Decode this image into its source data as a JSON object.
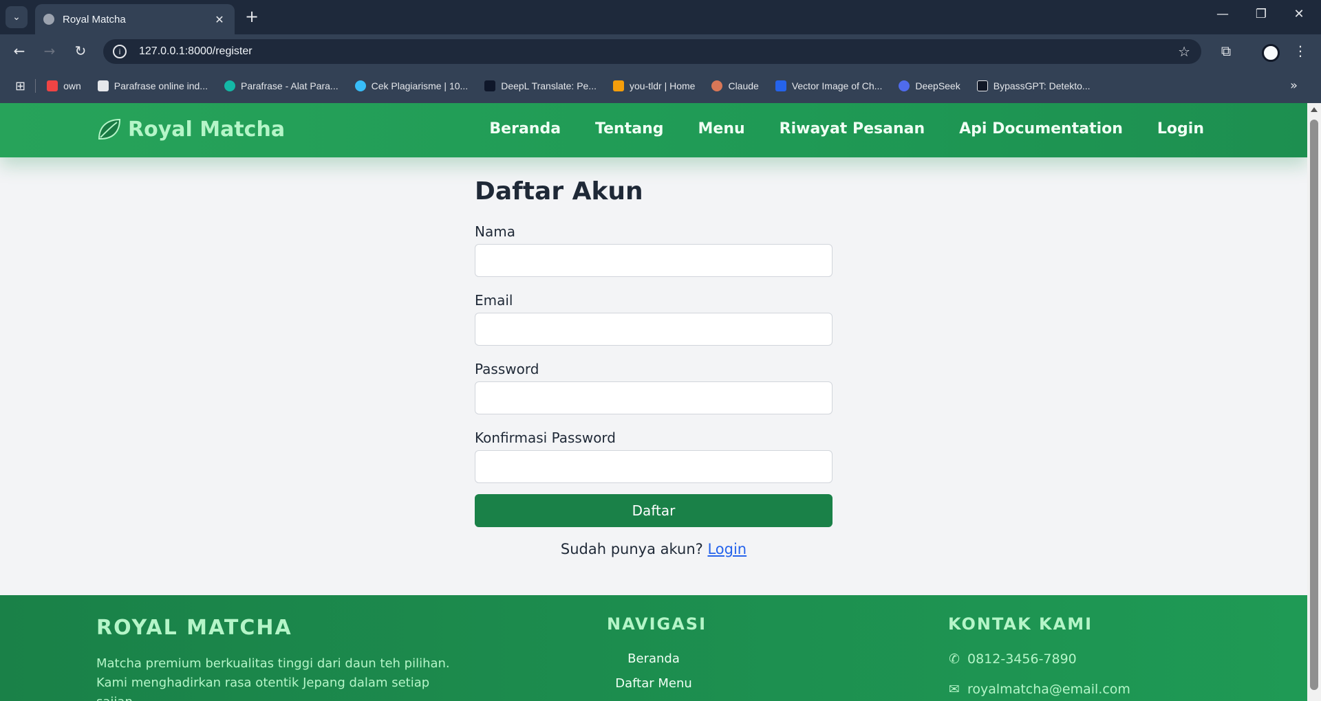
{
  "browser": {
    "tab_title": "Royal Matcha",
    "url": "127.0.0.1:8000/register",
    "bookmarks": [
      {
        "label": "own",
        "color": "#ef4444"
      },
      {
        "label": "Parafrase online ind...",
        "color": "#e5e7eb"
      },
      {
        "label": "Parafrase - Alat Para...",
        "color": "#14b8a6"
      },
      {
        "label": "Cek Plagiarisme | 10...",
        "color": "#38bdf8"
      },
      {
        "label": "DeepL Translate: Pe...",
        "color": "#0f172a"
      },
      {
        "label": "you-tldr | Home",
        "color": "#f59e0b"
      },
      {
        "label": "Claude",
        "color": "#d97757"
      },
      {
        "label": "Vector Image of Ch...",
        "color": "#2563eb"
      },
      {
        "label": "DeepSeek",
        "color": "#4f6bed"
      },
      {
        "label": "BypassGPT: Detekto...",
        "color": "#111827"
      }
    ]
  },
  "site": {
    "brand": "Royal Matcha",
    "nav": [
      "Beranda",
      "Tentang",
      "Menu",
      "Riwayat Pesanan",
      "Api Documentation",
      "Login"
    ],
    "colors": {
      "primary": "#1a8148",
      "accent": "#b5f5c8",
      "link": "#2563eb"
    }
  },
  "form": {
    "title": "Daftar Akun",
    "fields": [
      {
        "label": "Nama",
        "value": ""
      },
      {
        "label": "Email",
        "value": ""
      },
      {
        "label": "Password",
        "value": ""
      },
      {
        "label": "Konfirmasi Password",
        "value": ""
      }
    ],
    "submit_label": "Daftar",
    "login_prompt": "Sudah punya akun?",
    "login_link": "Login"
  },
  "footer": {
    "brand": "ROYAL MATCHA",
    "description": "Matcha premium berkualitas tinggi dari daun teh pilihan. Kami menghadirkan rasa otentik Jepang dalam setiap sajian.",
    "nav_title": "NAVIGASI",
    "nav_items": [
      "Beranda",
      "Daftar Menu"
    ],
    "contact_title": "KONTAK KAMI",
    "phone": "0812-3456-7890",
    "email": "royalmatcha@email.com"
  }
}
